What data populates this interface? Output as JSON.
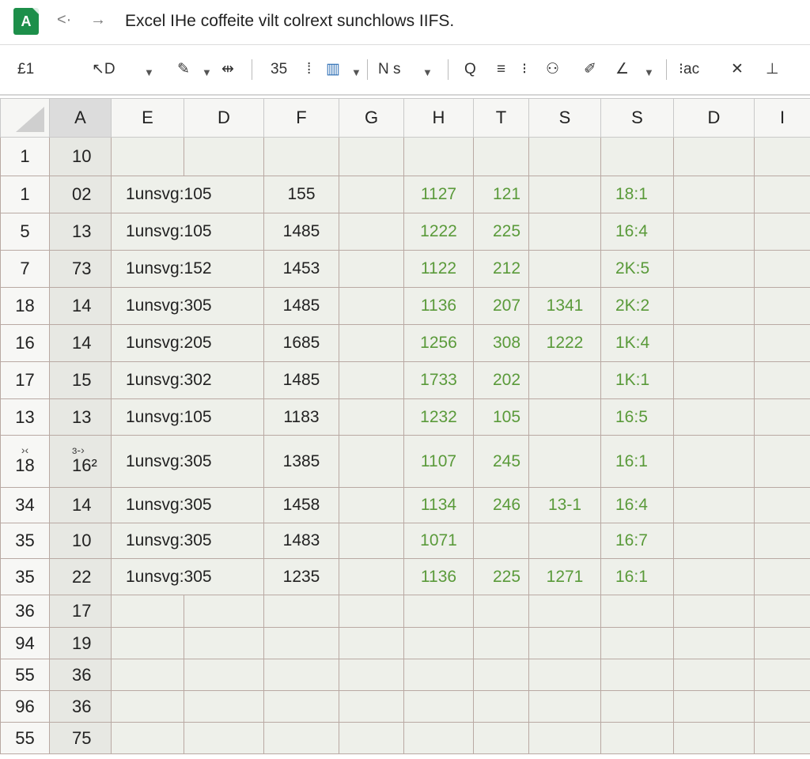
{
  "app": {
    "logo_letter": "A",
    "title": "Excel IHe coffeite vilt colrext sunchlows IIFS."
  },
  "nav": {
    "back": "<·",
    "forward": "→"
  },
  "toolbar": {
    "cell_ref": "£1",
    "undo": "↖D",
    "font_size": "35",
    "number_format": "N s",
    "items": [
      "Q",
      "≡",
      "⁝ac",
      "✕"
    ]
  },
  "columns": [
    "A",
    "E",
    "D",
    "F",
    "G",
    "H",
    "T",
    "S",
    "S",
    "D",
    "I"
  ],
  "rows": [
    {
      "rh": "1",
      "a": "10",
      "e": "",
      "f": "",
      "h": "",
      "t": "",
      "s1": "",
      "s2": ""
    },
    {
      "rh": "1",
      "a": "02",
      "e": "1unsvg:105",
      "f": "155",
      "h": "1127",
      "t": "121",
      "s1": "",
      "s2": "18:1"
    },
    {
      "rh": "5",
      "a": "13",
      "e": "1unsvg:105",
      "f": "1485",
      "h": "1222",
      "t": "225",
      "s1": "",
      "s2": "16:4"
    },
    {
      "rh": "7",
      "a": "73",
      "e": "1unsvg:152",
      "f": "1453",
      "h": "1122",
      "t": "212",
      "s1": "",
      "s2": "2K:5"
    },
    {
      "rh": "18",
      "a": "14",
      "e": "1unsvg:305",
      "f": "1485",
      "h": "1136",
      "t": "207",
      "s1": "1341",
      "s2": "2K:2"
    },
    {
      "rh": "16",
      "a": "14",
      "e": "1unsvg:205",
      "f": "1685",
      "h": "1256",
      "t": "308",
      "s1": "1222",
      "s2": "1K:4"
    },
    {
      "rh": "17",
      "a": "15",
      "e": "1unsvg:302",
      "f": "1485",
      "h": "1733",
      "t": "202",
      "s1": "",
      "s2": "1K:1"
    },
    {
      "rh": "13",
      "a": "13",
      "e": "1unsvg:105",
      "f": "1183",
      "h": "1232",
      "t": "105",
      "s1": "",
      "s2": "16:5"
    },
    {
      "rh": "18",
      "rh_top": "›‹",
      "a": "16²",
      "a_top": "ɜ-›",
      "e": "1unsvg:305",
      "f": "1385",
      "h": "1107",
      "t": "245",
      "s1": "",
      "s2": "16:1"
    },
    {
      "rh": "34",
      "a": "14",
      "e": "1unsvg:305",
      "f": "1458",
      "h": "1134",
      "t": "246",
      "s1": "13-1",
      "s2": "16:4"
    },
    {
      "rh": "35",
      "a": "10",
      "e": "1unsvg:305",
      "f": "1483",
      "h": "1071",
      "t": "",
      "s1": "",
      "s2": "16:7"
    },
    {
      "rh": "35",
      "a": "22",
      "e": "1unsvg:305",
      "f": "1235",
      "h": "1136",
      "t": "225",
      "s1": "1271",
      "s2": "16:1"
    },
    {
      "rh": "36",
      "a": "17",
      "e": "",
      "f": "",
      "h": "",
      "t": "",
      "s1": "",
      "s2": ""
    },
    {
      "rh": "94",
      "a": "19",
      "e": "",
      "f": "",
      "h": "",
      "t": "",
      "s1": "",
      "s2": ""
    },
    {
      "rh": "55",
      "a": "36",
      "e": "",
      "f": "",
      "h": "",
      "t": "",
      "s1": "",
      "s2": ""
    },
    {
      "rh": "96",
      "a": "36",
      "e": "",
      "f": "",
      "h": "",
      "t": "",
      "s1": "",
      "s2": ""
    },
    {
      "rh": "55",
      "a": "75",
      "e": "",
      "f": "",
      "h": "",
      "t": "",
      "s1": "",
      "s2": ""
    }
  ]
}
